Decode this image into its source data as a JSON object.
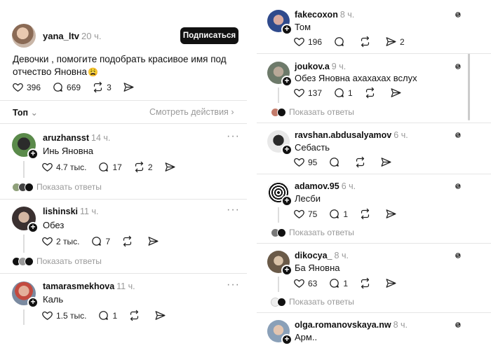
{
  "left": {
    "post": {
      "author": "yana_ltv",
      "time": "20 ч.",
      "follow_label": "Подписаться",
      "text_line1": "Девочки , помогите подобрать красивое имя под",
      "text_line2": "отчество Яновна",
      "emoji": "😩",
      "likes": "396",
      "comments": "669",
      "reposts": "3"
    },
    "sort": {
      "label": "Топ",
      "view_activity": "Смотреть действия"
    },
    "replies": [
      {
        "author": "aruzhansst",
        "time": "14 ч.",
        "text": "Инь Яновна",
        "likes": "4.7 тыс.",
        "comments": "17",
        "reposts": "2",
        "show_replies": "Показать ответы"
      },
      {
        "author": "lishinski",
        "time": "11 ч.",
        "text": "Обез",
        "likes": "2 тыс.",
        "comments": "7",
        "reposts": "",
        "show_replies": "Показать ответы"
      },
      {
        "author": "tamarasmekhova",
        "time": "11 ч.",
        "text": "Каль",
        "likes": "1.5 тыс.",
        "comments": "1",
        "reposts": ""
      }
    ]
  },
  "right": {
    "replies": [
      {
        "author": "fakecoxon",
        "time": "8 ч.",
        "text": "Том",
        "likes": "196",
        "comments": "",
        "reposts": "",
        "shares": "2"
      },
      {
        "author": "joukov.a",
        "time": "9 ч.",
        "text": "Обез Яновна ахахахах вслух",
        "likes": "137",
        "comments": "1",
        "show_replies": "Показать ответы"
      },
      {
        "author": "ravshan.abdusalyamov",
        "time": "6 ч.",
        "text": "Себасть",
        "likes": "95"
      },
      {
        "author": "adamov.95",
        "time": "6 ч.",
        "text": "Лесби",
        "likes": "75",
        "comments": "1",
        "show_replies": "Показать ответы"
      },
      {
        "author": "dikocya_",
        "time": "8 ч.",
        "text": "Ба Яновна",
        "likes": "63",
        "comments": "1",
        "show_replies": "Показать ответы"
      },
      {
        "author": "olga.romanovskaya.nw",
        "time": "8 ч.",
        "text": "Арм.."
      }
    ]
  },
  "colors": {
    "text": "#111111",
    "muted": "#999999",
    "button_bg": "#111111",
    "divider": "#e5e5e5"
  }
}
